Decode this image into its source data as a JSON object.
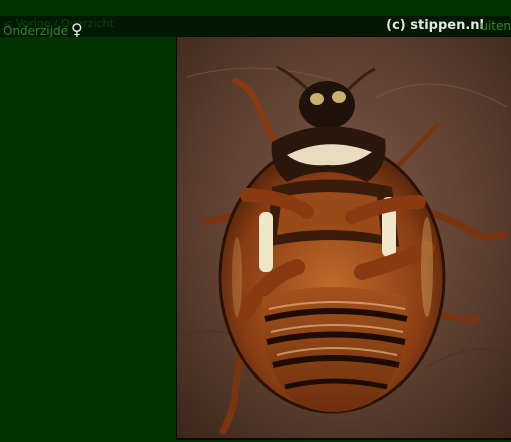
{
  "page": {
    "back_link": "< Vorige / Overzicht",
    "caption": "Onderzijde",
    "caption_symbol": "♀",
    "credit": "(c) stippen.nl",
    "next_link": "uiten"
  },
  "photo": {
    "subject": "Beetle, underside (female)",
    "icon": "photo-icon"
  },
  "colors": {
    "background": "#003300",
    "titlebar": "#001900",
    "link": "#2e8b2e",
    "credit_text": "#e6e6e6"
  }
}
